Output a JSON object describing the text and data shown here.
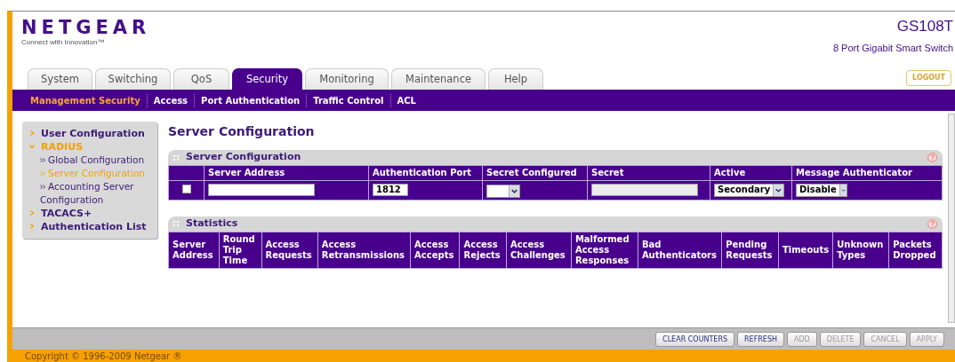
{
  "header": {
    "brand": "NETGEAR",
    "tagline": "Connect with Innovation™",
    "model": "GS108T",
    "product": "8 Port Gigabit Smart Switch",
    "logout": "LOGOUT"
  },
  "tabs": [
    {
      "label": "System",
      "selected": false
    },
    {
      "label": "Switching",
      "selected": false
    },
    {
      "label": "QoS",
      "selected": false
    },
    {
      "label": "Security",
      "selected": true
    },
    {
      "label": "Monitoring",
      "selected": false
    },
    {
      "label": "Maintenance",
      "selected": false
    },
    {
      "label": "Help",
      "selected": false
    }
  ],
  "subnav": [
    {
      "label": "Management Security",
      "selected": true
    },
    {
      "label": "Access",
      "selected": false
    },
    {
      "label": "Port Authentication",
      "selected": false
    },
    {
      "label": "Traffic Control",
      "selected": false
    },
    {
      "label": "ACL",
      "selected": false
    }
  ],
  "sidebar": {
    "items": [
      {
        "label": "User Configuration",
        "expanded": false
      },
      {
        "label": "RADIUS",
        "expanded": true,
        "children": [
          {
            "label": "Global Configuration",
            "selected": false
          },
          {
            "label": "Server Configuration",
            "selected": true
          },
          {
            "label": "Accounting Server Configuration",
            "selected": false
          }
        ]
      },
      {
        "label": "TACACS+",
        "expanded": false
      },
      {
        "label": "Authentication List",
        "expanded": false
      }
    ]
  },
  "page_title": "Server Configuration",
  "server_panel": {
    "title": "Server Configuration",
    "columns": [
      "Server Address",
      "Authentication Port",
      "Secret Configured",
      "Secret",
      "Active",
      "Message Authenticator"
    ],
    "row": {
      "checked": false,
      "authentication_port": "1812",
      "secret_disabled": true,
      "active": "Secondary",
      "message_authenticator": "Disable"
    }
  },
  "statistics_panel": {
    "title": "Statistics",
    "columns": [
      "Server Address",
      "Round Trip Time",
      "Access Requests",
      "Access Retransmissions",
      "Access Accepts",
      "Access Rejects",
      "Access Challenges",
      "Malformed Access Responses",
      "Bad Authenticators",
      "Pending Requests",
      "Timeouts",
      "Unknown Types",
      "Packets Dropped"
    ]
  },
  "buttons": [
    {
      "label": "CLEAR COUNTERS",
      "disabled": false
    },
    {
      "label": "REFRESH",
      "disabled": false
    },
    {
      "label": "ADD",
      "disabled": true
    },
    {
      "label": "DELETE",
      "disabled": true
    },
    {
      "label": "CANCEL",
      "disabled": true
    },
    {
      "label": "APPLY",
      "disabled": true
    }
  ],
  "footer": {
    "copyright": "Copyright © 1996-2009 Netgear ®"
  }
}
